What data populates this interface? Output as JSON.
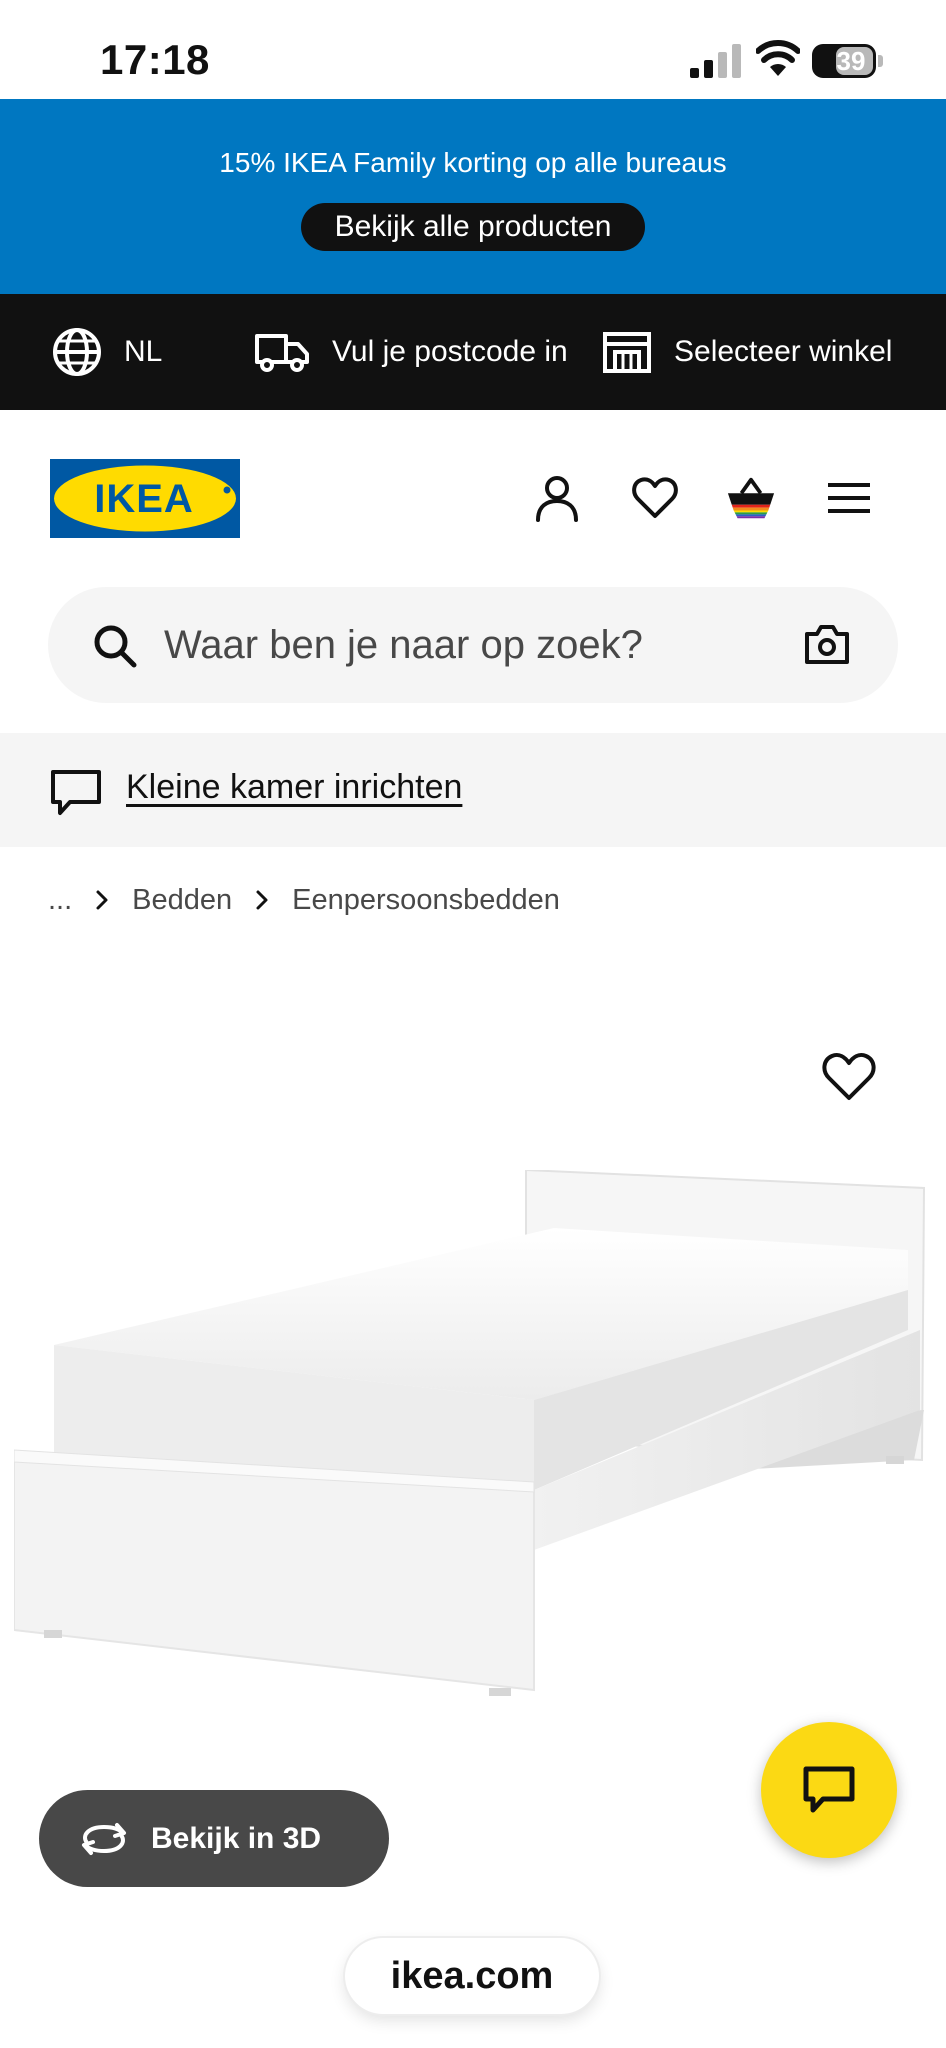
{
  "status_bar": {
    "time": "17:18",
    "battery": "39"
  },
  "promo": {
    "text": "15% IKEA Family korting op alle bureaus",
    "button_label": "Bekijk alle producten"
  },
  "utility_bar": {
    "language": "NL",
    "postcode": "Vul je postcode in",
    "store": "Selecteer winkel"
  },
  "header": {
    "logo_text": "IKEA",
    "icons": [
      "user-icon",
      "heart-icon",
      "basket-icon",
      "menu-icon"
    ]
  },
  "search": {
    "placeholder": "Waar ben je naar op zoek?"
  },
  "inspiration": {
    "link": "Kleine kamer inrichten"
  },
  "breadcrumb": {
    "ellipsis": "...",
    "items": [
      "Bedden",
      "Eenpersoonsbedden"
    ]
  },
  "product": {
    "view_3d_label": "Bekijk in 3D"
  },
  "browser": {
    "url": "ikea.com"
  },
  "colors": {
    "promo_bg": "#0077c1",
    "utility_bg": "#111111",
    "logo_blue": "#0058a3",
    "logo_yellow": "#ffdb00",
    "chat_fab": "#fbd914",
    "view3d_bg": "#484848"
  }
}
